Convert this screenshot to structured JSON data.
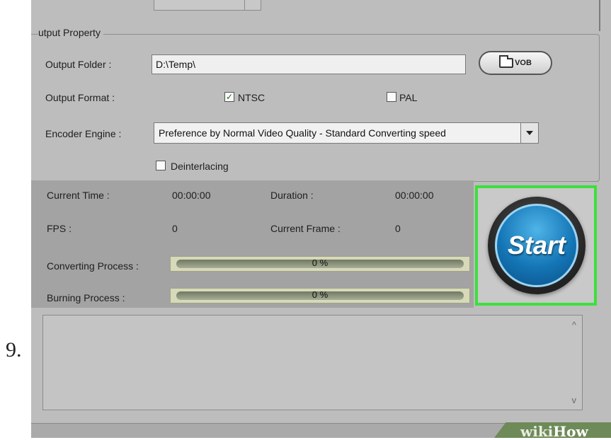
{
  "step_number": "9.",
  "output_property": {
    "group_title": "utput Property",
    "output_folder_label": "Output Folder :",
    "output_folder_value": "D:\\Temp\\",
    "vob_button_label": "VOB",
    "output_format_label": "Output Format :",
    "ntsc_label": "NTSC",
    "ntsc_checked": true,
    "pal_label": "PAL",
    "pal_checked": false,
    "encoder_engine_label": "Encoder Engine :",
    "encoder_engine_value": "Preference by Normal Video Quality - Standard Converting speed",
    "deinterlacing_label": "Deinterlacing",
    "deinterlacing_checked": false
  },
  "stats": {
    "current_time_label": "Current Time :",
    "current_time_value": "00:00:00",
    "duration_label": "Duration :",
    "duration_value": "00:00:00",
    "fps_label": "FPS :",
    "fps_value": "0",
    "current_frame_label": "Current Frame :",
    "current_frame_value": "0",
    "converting_label": "Converting Process :",
    "converting_value": "0 %",
    "burning_label": "Burning Process :",
    "burning_value": "0 %"
  },
  "start_button_label": "Start",
  "colors": {
    "highlight": "#3ce03c",
    "start_blue": "#1476b6"
  },
  "watermark": {
    "part1": "wiki",
    "part2": "How"
  }
}
